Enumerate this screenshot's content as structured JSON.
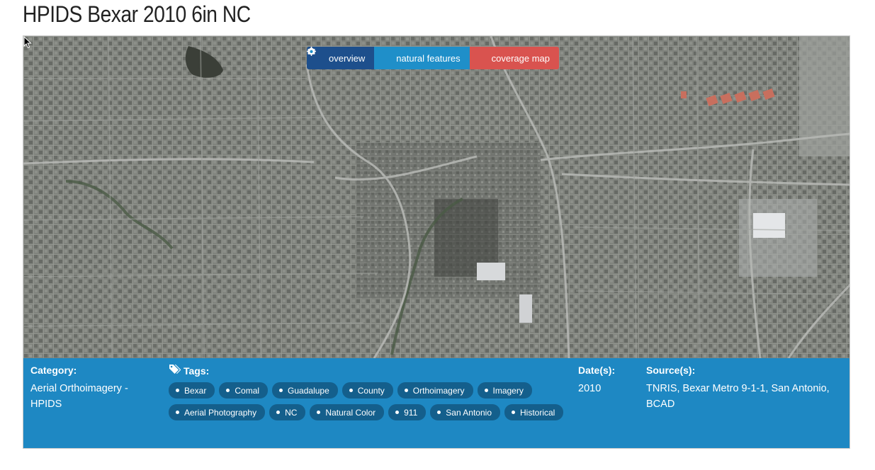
{
  "page": {
    "title": "HPIDS Bexar 2010 6in NC"
  },
  "map_buttons": {
    "overview": {
      "label": "overview",
      "icon": "camera-icon",
      "color": "#1d4f8c"
    },
    "natural": {
      "label": "natural features",
      "icon": "camera-icon",
      "color": "#1f8fc9"
    },
    "coverage": {
      "label": "coverage map",
      "icon": "crosshair-icon",
      "color": "#d9534f"
    }
  },
  "info": {
    "background": "#1e88c3",
    "category": {
      "label": "Category:",
      "value": "Aerial Orthoimagery - HPIDS"
    },
    "tags": {
      "label": "Tags:",
      "icon": "tags-icon",
      "items": [
        "Bexar",
        "Comal",
        "Guadalupe",
        "County",
        "Orthoimagery",
        "Imagery",
        "Aerial Photography",
        "NC",
        "Natural Color",
        "911",
        "San Antonio",
        "Historical"
      ]
    },
    "dates": {
      "label": "Date(s):",
      "value": "2010"
    },
    "sources": {
      "label": "Source(s):",
      "value": "TNRIS, Bexar Metro 9-1-1, San Antonio, BCAD"
    }
  }
}
